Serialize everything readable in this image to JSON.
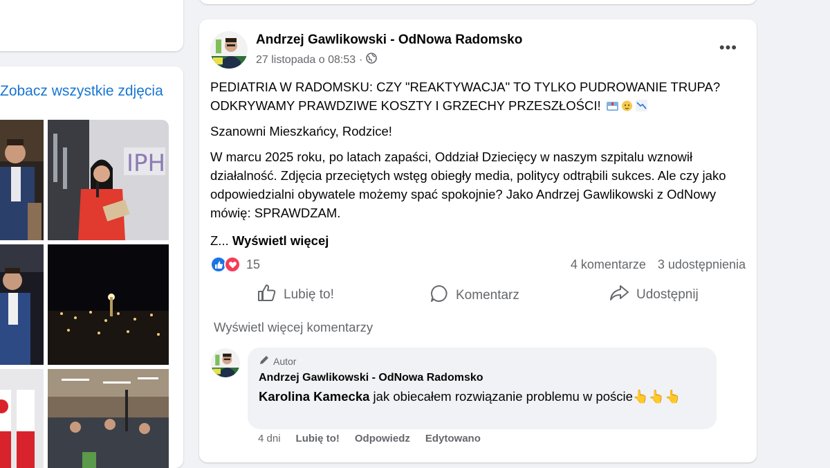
{
  "sidebar": {
    "see_all_photos": "Zobacz wszystkie zdjęcia"
  },
  "post": {
    "author": "Andrzej Gawlikowski - OdNowa Radomsko",
    "timestamp": "27 listopada o 08:53",
    "separator": "·",
    "privacy_icon": "globe-icon",
    "more_icon": "ellipsis-icon",
    "more_symbol": "•••",
    "headline_line1": "PEDIATRIA W RADOMSKU: CZY \"REAKTYWACJA\" TO TYLKO PUDROWANIE TRUPA?",
    "headline_line2": "ODKRYWAMY PRAWDZIWE KOSZTY I GRZECHY PRZESZŁOŚCI!",
    "greeting": "Szanowni Mieszkańcy, Rodzice!",
    "body": "W marcu 2025 roku, po latach zapaści, Oddział Dziecięcy w naszym szpitalu wznowił działalność. Zdjęcia przeciętych wstęg obiegły media, politycy odtrąbili sukces. Ale czy jako odpowiedzialni obywatele możemy spać spokojnie? Jako Andrzej Gawlikowski z OdNowy mówię: SPRAWDZAM.",
    "truncated_prefix": "Z...",
    "see_more": "Wyświetl więcej",
    "reactions_count": "15",
    "comments_count": "4 komentarze",
    "shares_count": "3 udostępnienia",
    "actions": {
      "like": "Lubię to!",
      "comment": "Komentarz",
      "share": "Udostępnij"
    },
    "view_more_comments": "Wyświetl więcej komentarzy"
  },
  "comment": {
    "badge": "Autor",
    "author": "Andrzej Gawlikowski - OdNowa Radomsko",
    "mention": "Karolina Kamecka",
    "text": " jak obiecałem rozwiązanie problemu w poście👆👆👆",
    "age": "4 dni",
    "like": "Lubię to!",
    "reply": "Odpowiedz",
    "edited": "Edytowano"
  },
  "colors": {
    "link_blue": "#1876d1",
    "like_blue": "#1b74e4",
    "love_red": "#f33e58",
    "muted_text": "#65676b",
    "page_bg": "#f0f2f5"
  }
}
